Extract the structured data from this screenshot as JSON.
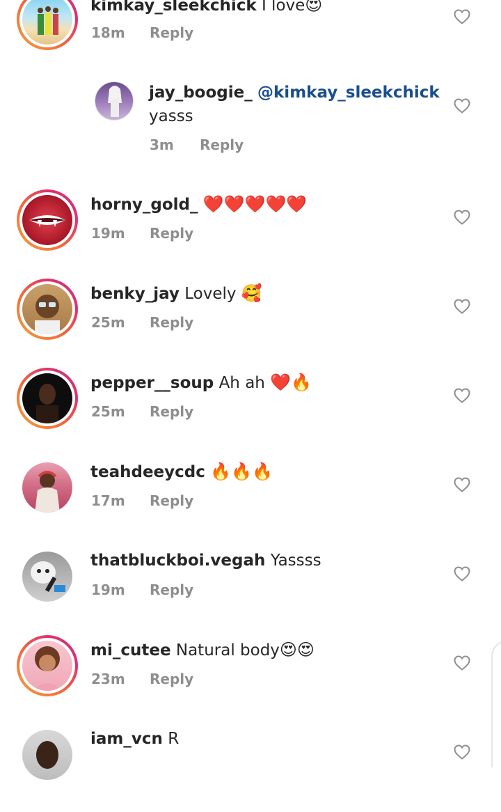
{
  "reply_label": "Reply",
  "comments": [
    {
      "username": "kimkay_sleekchick",
      "text": "I love",
      "emoji": "😍",
      "time": "18m"
    },
    {
      "username": "jay_boogie_",
      "mention": "@kimkay_sleekchick",
      "text": "yasss",
      "emoji": "",
      "time": "3m"
    },
    {
      "username": "horny_gold_",
      "text": "",
      "emoji": "❤️❤️❤️❤️❤️",
      "time": "19m"
    },
    {
      "username": "benky_jay",
      "text": "Lovely",
      "emoji": "🥰",
      "time": "25m"
    },
    {
      "username": "pepper__soup",
      "text": "Ah ah",
      "emoji": "❤️🔥",
      "time": "25m"
    },
    {
      "username": "teahdeeycdc",
      "text": "",
      "emoji": "🔥🔥🔥",
      "time": "17m"
    },
    {
      "username": "thatbluckboi.vegah",
      "text": "Yassss",
      "emoji": "",
      "time": "19m"
    },
    {
      "username": "mi_cutee",
      "text": "Natural body",
      "emoji": "😍😍",
      "time": "23m"
    },
    {
      "username": "iam_vcn",
      "text": "R",
      "emoji": "",
      "time": ""
    }
  ],
  "colors": {
    "accent_link": "#1a4f8c",
    "meta_gray": "#8e8e8e",
    "story_ring": "#e1306c"
  }
}
